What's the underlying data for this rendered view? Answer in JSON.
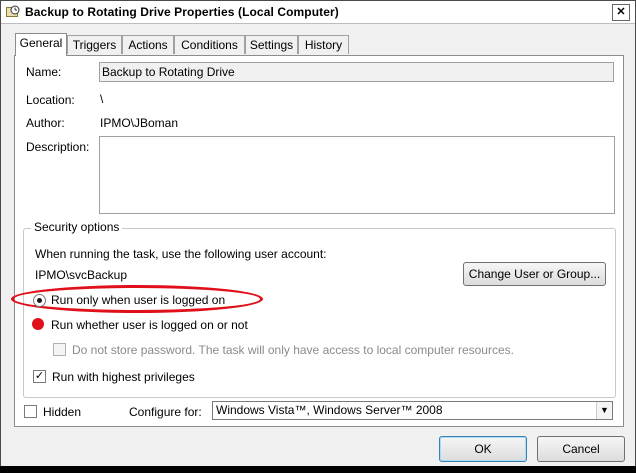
{
  "window": {
    "title": "Backup to Rotating Drive Properties (Local Computer)",
    "close_glyph": "✕"
  },
  "tabs": [
    "General",
    "Triggers",
    "Actions",
    "Conditions",
    "Settings",
    "History"
  ],
  "general": {
    "name_label": "Name:",
    "name_value": "Backup to Rotating Drive",
    "location_label": "Location:",
    "location_value": "\\",
    "author_label": "Author:",
    "author_value": "IPMO\\JBoman",
    "description_label": "Description:",
    "description_value": ""
  },
  "security": {
    "legend": "Security options",
    "account_prompt": "When running the task, use the following user account:",
    "account_value": "IPMO\\svcBackup",
    "change_button": "Change User or Group...",
    "radio_logged_on": "Run only when user is logged on",
    "radio_whether": "Run whether user is logged on or not",
    "no_store_password": "Do not store password.  The task will only have access to local computer resources.",
    "highest_privileges": "Run with highest privileges"
  },
  "bottom": {
    "hidden_label": "Hidden",
    "configure_label": "Configure for:",
    "configure_value": "Windows Vista™, Windows Server™ 2008"
  },
  "buttons": {
    "ok": "OK",
    "cancel": "Cancel"
  },
  "colors": {
    "annotation_red": "#e0101a"
  }
}
